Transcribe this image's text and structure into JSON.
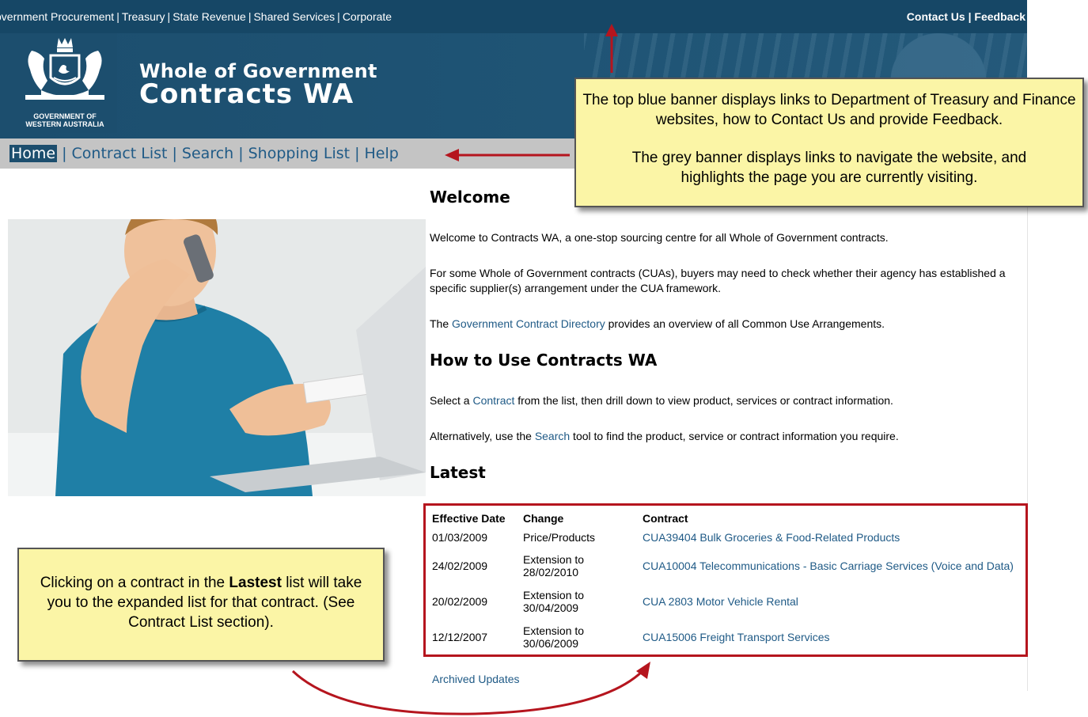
{
  "top_links": {
    "left": [
      "Government Procurement",
      "Treasury",
      "State Revenue",
      "Shared Services",
      "Corporate"
    ],
    "left_first_visible": "overnment Procurement",
    "right": [
      "Contact Us",
      "Feedback"
    ]
  },
  "logo": {
    "org_line1": "GOVERNMENT OF",
    "org_line2": "WESTERN AUSTRALIA"
  },
  "site_title": {
    "line1": "Whole of Government",
    "line2": "Contracts WA"
  },
  "nav": {
    "items": [
      "Home",
      "Contract List",
      "Search",
      "Shopping List",
      "Help"
    ],
    "active": "Home"
  },
  "main": {
    "welcome_heading": "Welcome",
    "para1": "Welcome to Contracts WA, a one-stop sourcing centre for all Whole of Government contracts.",
    "para2": "For some Whole of Government contracts (CUAs), buyers may need to check whether their agency has established a specific supplier(s) arrangement under the CUA framework.",
    "para3_before": "The ",
    "para3_link": "Government Contract Directory",
    "para3_after": " provides an overview of all Common Use Arrangements.",
    "howto_heading": "How to Use Contracts WA",
    "para4_before": "Select a ",
    "para4_link": "Contract",
    "para4_after": " from the list, then drill down to view product, services or contract information.",
    "para5_before": "Alternatively, use the ",
    "para5_link": "Search",
    "para5_after": " tool to find the product, service or contract information you require.",
    "latest_heading": "Latest"
  },
  "latest": {
    "headers": [
      "Effective Date",
      "Change",
      "Contract"
    ],
    "rows": [
      {
        "date": "01/03/2009",
        "change_line1": "Price/Products",
        "change_line2": "",
        "contract": "CUA39404 Bulk Groceries & Food-Related Products"
      },
      {
        "date": "24/02/2009",
        "change_line1": "Extension to",
        "change_line2": "28/02/2010",
        "contract": "CUA10004 Telecommunications - Basic Carriage Services (Voice and Data)"
      },
      {
        "date": "20/02/2009",
        "change_line1": "Extension to",
        "change_line2": "30/04/2009",
        "contract": "CUA 2803 Motor Vehicle Rental"
      },
      {
        "date": "12/12/2007",
        "change_line1": "Extension to",
        "change_line2": "30/06/2009",
        "contract": "CUA15006 Freight Transport Services"
      }
    ],
    "archived_link": "Archived Updates"
  },
  "callouts": {
    "top_line1": "The top blue banner displays links to Department of Treasury and Finance websites, how to Contact Us and provide Feedback.",
    "top_line2": "The grey banner displays links to navigate the website, and highlights the page you are currently visiting.",
    "bottom_before": "Clicking on a contract in the ",
    "bottom_bold": "Lastest",
    "bottom_after": " list will take you to the expanded list for that contract. (See Contract List section)."
  },
  "colors": {
    "banner_blue": "#1c4e6e",
    "nav_grey": "#c4c4c4",
    "link_blue": "#1f5a86",
    "callout_yellow": "#fbf5a6",
    "annotation_red": "#b5151e"
  }
}
